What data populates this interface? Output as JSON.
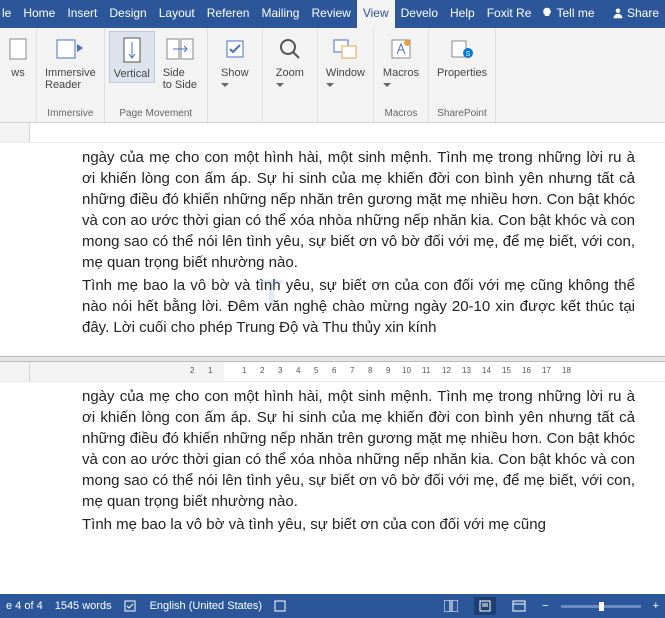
{
  "tabs": {
    "partial_left": "le",
    "items": [
      "Home",
      "Insert",
      "Design",
      "Layout",
      "Referen",
      "Mailing",
      "Review",
      "View",
      "Develo",
      "Help",
      "Foxit Re"
    ],
    "active": "View",
    "tellme": "Tell me",
    "share": "Share"
  },
  "ribbon": {
    "groups": [
      {
        "label": "",
        "controls": [
          {
            "label": "ws"
          }
        ]
      },
      {
        "label": "Immersive",
        "controls": [
          {
            "label": "Immersive\nReader"
          }
        ]
      },
      {
        "label": "Page Movement",
        "controls": [
          {
            "label": "Vertical",
            "hl": true
          },
          {
            "label": "Side\nto Side"
          }
        ]
      },
      {
        "label": "",
        "controls": [
          {
            "label": "Show",
            "drop": true
          }
        ]
      },
      {
        "label": "",
        "controls": [
          {
            "label": "Zoom",
            "drop": true
          }
        ]
      },
      {
        "label": "",
        "controls": [
          {
            "label": "Window",
            "drop": true
          }
        ]
      },
      {
        "label": "Macros",
        "controls": [
          {
            "label": "Macros",
            "drop": true
          }
        ]
      },
      {
        "label": "SharePoint",
        "controls": [
          {
            "label": "Properties"
          }
        ]
      }
    ]
  },
  "document": {
    "para1": "ngày của mẹ cho con một hình hài, một sinh mệnh. Tình mẹ trong những lời ru à ơi khiến lòng con ấm áp. Sự hi sinh của mẹ khiến đời con bình yên nhưng tất cả những điều đó khiến những nếp nhăn trên gương mặt mẹ nhiều hơn. Con bật khóc và con ao ước thời gian có thể xóa nhòa những nếp nhăn kia. Con bật khóc và con mong sao có thể nói lên tình yêu, sự biết ơn vô bờ đối với mẹ, để mẹ biết, với con, mẹ quan trọng biết nhường nào.",
    "para2": "Tình mẹ bao la vô bờ và tình yêu, sự biết ơn của con đối với mẹ cũng không thể nào nói hết bằng lời. Đêm văn nghệ chào mừng ngày 20-10 xin được kết thúc tại đây. Lời cuối cho phép Trung Độ và Thu thủy xin kính",
    "para3": "ngày của mẹ cho con một hình hài, một sinh mệnh. Tình mẹ trong những lời ru à ơi khiến lòng con ấm áp. Sự hi sinh của mẹ khiến đời con bình yên nhưng tất cả những điều đó khiến những nếp nhăn trên gương mặt mẹ nhiều hơn. Con bật khóc và con ao ước thời gian có thể xóa nhòa những nếp nhăn kia. Con bật khóc và con mong sao có thể nói lên tình yêu, sự biết ơn vô bờ đối với mẹ, để mẹ biết, với con, mẹ quan trọng biết nhường nào.",
    "para4": "Tình mẹ bao la vô bờ và tình yêu, sự biết ơn của con đối với mẹ cũng"
  },
  "status": {
    "page": "e 4 of 4",
    "words": "1545 words",
    "lang": "English (United States)",
    "zoom": "+"
  },
  "ruler": {
    "ticks": [
      "2",
      "1",
      "1",
      "2",
      "3",
      "4",
      "5",
      "6",
      "7",
      "8",
      "9",
      "10",
      "11",
      "12",
      "13",
      "14",
      "15",
      "16",
      "17",
      "18"
    ]
  }
}
